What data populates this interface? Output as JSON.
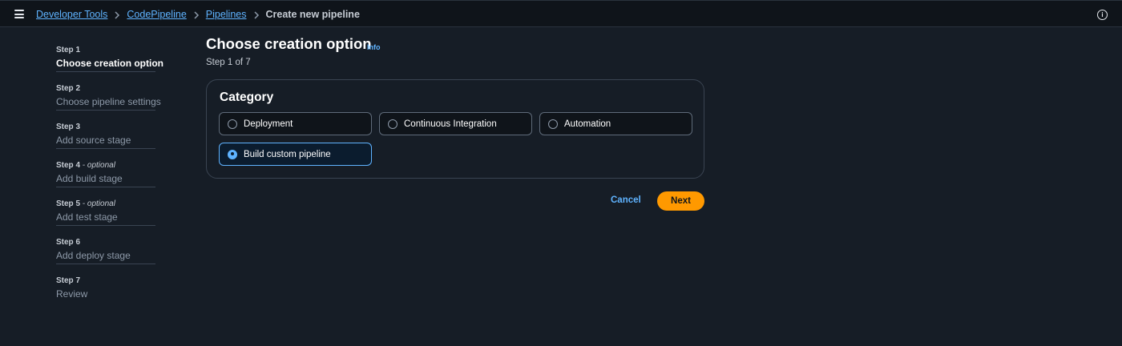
{
  "header": {
    "breadcrumbs": [
      {
        "label": "Developer Tools"
      },
      {
        "label": "CodePipeline"
      },
      {
        "label": "Pipelines"
      }
    ],
    "current": "Create new pipeline",
    "menu_icon": "hamburger-menu-icon",
    "help_icon": "info-circle-icon"
  },
  "steps": [
    {
      "num": "Step 1",
      "optional": "",
      "label": "Choose creation option",
      "active": true
    },
    {
      "num": "Step 2",
      "optional": "",
      "label": "Choose pipeline settings",
      "active": false
    },
    {
      "num": "Step 3",
      "optional": "",
      "label": "Add source stage",
      "active": false
    },
    {
      "num": "Step 4",
      "optional": " - optional",
      "label": "Add build stage",
      "active": false
    },
    {
      "num": "Step 5",
      "optional": " - optional",
      "label": "Add test stage",
      "active": false
    },
    {
      "num": "Step 6",
      "optional": "",
      "label": "Add deploy stage",
      "active": false
    },
    {
      "num": "Step 7",
      "optional": "",
      "label": "Review",
      "active": false
    }
  ],
  "main": {
    "title": "Choose creation option",
    "info": "Info",
    "step_count": "Step 1 of 7",
    "category": {
      "title": "Category",
      "options": [
        {
          "label": "Deployment",
          "selected": false
        },
        {
          "label": "Continuous Integration",
          "selected": false
        },
        {
          "label": "Automation",
          "selected": false
        },
        {
          "label": "Build custom pipeline",
          "selected": true
        }
      ]
    },
    "cancel": "Cancel",
    "next": "Next"
  },
  "colors": {
    "background": "#161d26",
    "topbar": "#0f141a",
    "link": "#5fb3ff",
    "primary_button": "#ff9900"
  }
}
